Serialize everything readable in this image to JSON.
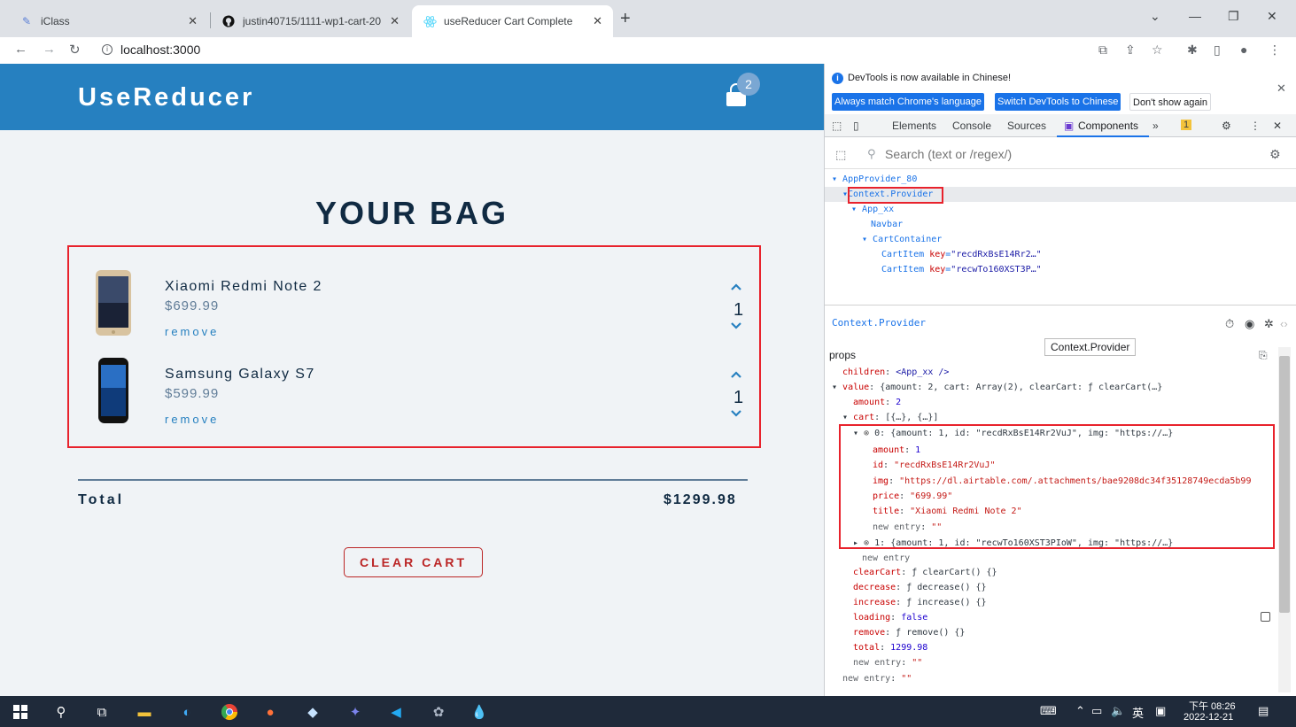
{
  "browser": {
    "tabs": [
      {
        "title": "iClass",
        "active": false
      },
      {
        "title": "justin40715/1111-wp1-cart-20",
        "active": false
      },
      {
        "title": "useReducer Cart Complete",
        "active": true
      }
    ],
    "url": "localhost:3000"
  },
  "app": {
    "brand": "UseReducer",
    "bag_count": "2",
    "bag_title": "YOUR BAG",
    "items": [
      {
        "title": "Xiaomi Redmi Note 2",
        "price": "$699.99",
        "remove_label": "remove",
        "amount": "1"
      },
      {
        "title": "Samsung Galaxy S7",
        "price": "$599.99",
        "remove_label": "remove",
        "amount": "1"
      }
    ],
    "total_label": "Total",
    "total_value": "$1299.98",
    "clear_label": "CLEAR CART"
  },
  "devtools": {
    "info_text": "DevTools is now available in Chinese!",
    "btn_match": "Always match Chrome's language",
    "btn_switch": "Switch DevTools to Chinese",
    "btn_dont_show": "Don't show again",
    "tabs": [
      "Elements",
      "Console",
      "Sources",
      "Components",
      "»"
    ],
    "issues_count": "1",
    "search_placeholder": "Search (text or /regex/)",
    "tree": {
      "r0": "AppProvider_80",
      "r1": "Context.Provider",
      "r2": "App_xx",
      "r3": "Navbar",
      "r4": "CartContainer",
      "r5_name": "CartItem",
      "r5_key": "key",
      "r5_val": "\"recdRxBsE14Rr2…\"",
      "r6_name": "CartItem",
      "r6_key": "key",
      "r6_val": "\"recwTo160XST3P…\""
    },
    "selected_name": "Context.Provider",
    "tooltip": "Context.Provider",
    "props_label": "props",
    "props": {
      "children_k": "children",
      "children_v": "<App_xx />",
      "value_k": "value",
      "value_v": "{amount: 2, cart: Array(2), clearCart: ƒ clearCart(…}",
      "amount_k": "amount",
      "amount_v": "2",
      "cart_k": "cart",
      "cart_v": "[{…}, {…}]",
      "c0_k": "0",
      "c0_v": "{amount: 1, id: \"recdRxBsE14Rr2VuJ\", img: \"https://…}",
      "c0_amount_k": "amount",
      "c0_amount_v": "1",
      "c0_id_k": "id",
      "c0_id_v": "\"recdRxBsE14Rr2VuJ\"",
      "c0_img_k": "img",
      "c0_img_v": "\"https://dl.airtable.com/.attachments/bae9208dc34f35128749ecda5b99",
      "c0_price_k": "price",
      "c0_price_v": "\"699.99\"",
      "c0_title_k": "title",
      "c0_title_v": "\"Xiaomi Redmi Note 2\"",
      "c0_new_k": "new entry",
      "c0_new_v": "\"\"",
      "c1_k": "1",
      "c1_v": "{amount: 1, id: \"recwTo160XST3PIoW\", img: \"https://…}",
      "cart_new": "new entry",
      "clearCart_k": "clearCart",
      "clearCart_v": "ƒ clearCart() {}",
      "decrease_k": "decrease",
      "decrease_v": "ƒ decrease() {}",
      "increase_k": "increase",
      "increase_v": "ƒ increase() {}",
      "loading_k": "loading",
      "loading_v": "false",
      "remove_k": "remove",
      "remove_v": "ƒ remove() {}",
      "total_k": "total",
      "total_v": "1299.98",
      "value_new_k": "new entry",
      "value_new_v": "\"\"",
      "root_new_k": "new entry",
      "root_new_v": "\"\""
    }
  },
  "taskbar": {
    "time": "下午 08:26",
    "date": "2022-12-21",
    "ime": "英"
  }
}
